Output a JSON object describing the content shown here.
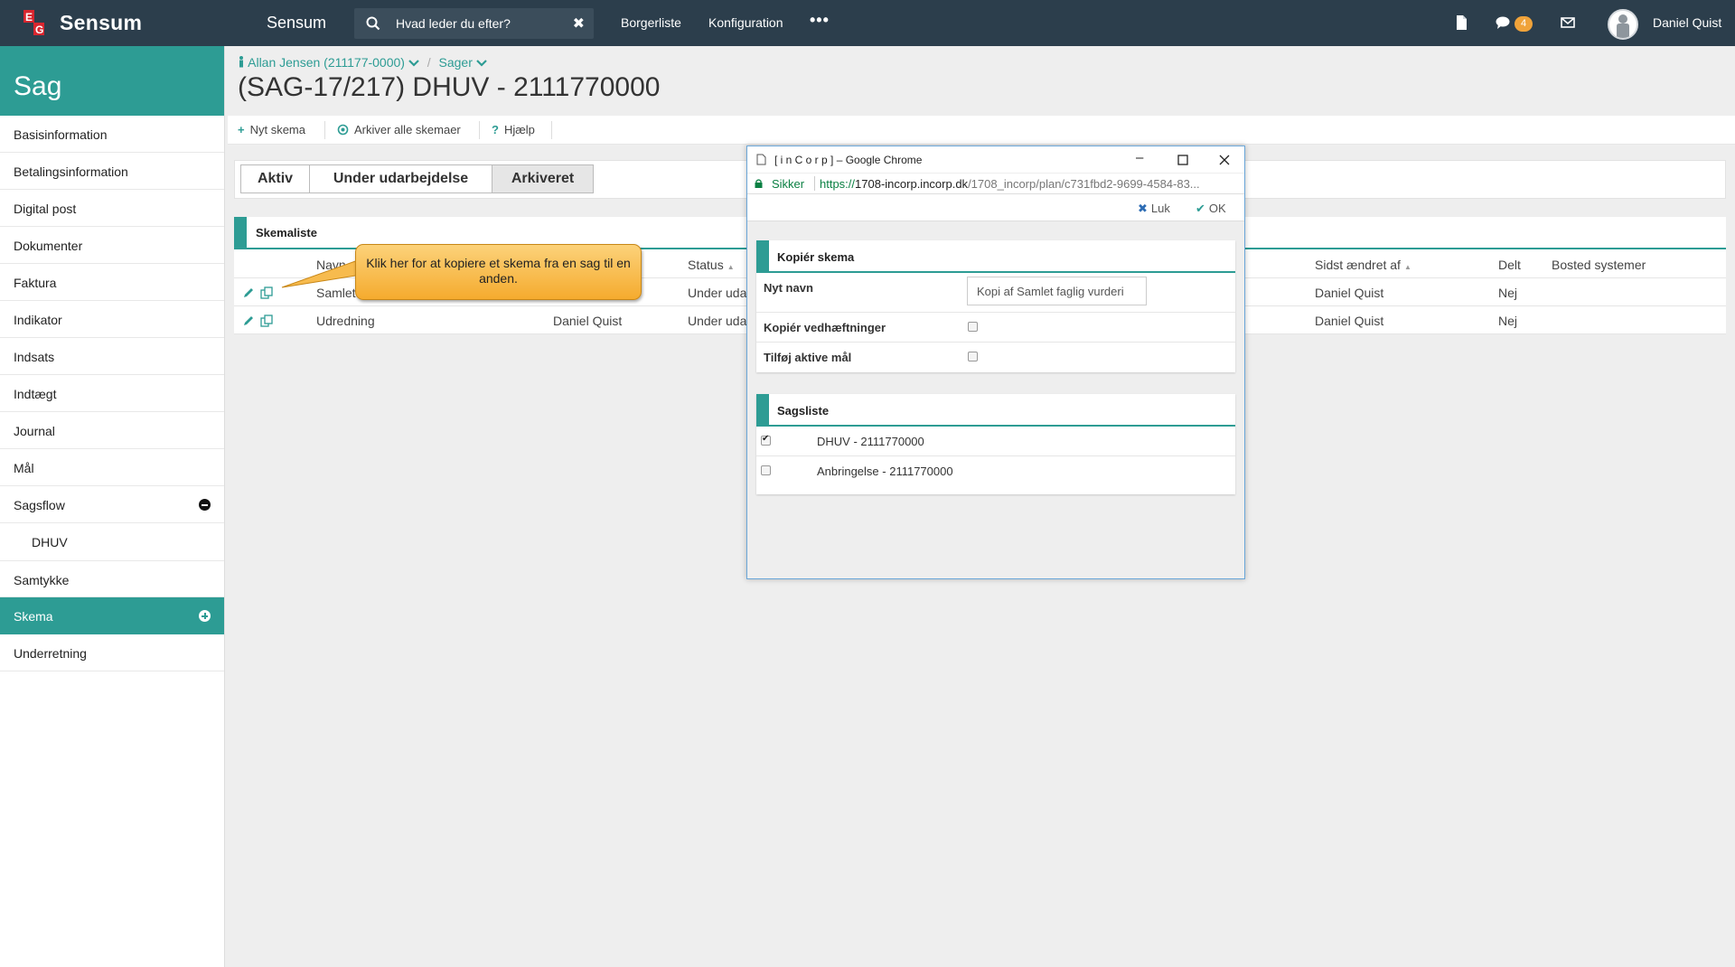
{
  "topbar": {
    "logo_text": "Sensum",
    "app_name": "Sensum",
    "search_placeholder": "Hvad leder du efter?",
    "search_clear": "✖",
    "nav": [
      "Borgerliste",
      "Konfiguration"
    ],
    "more": "•••",
    "badge_count": "4",
    "user_name": "Daniel Quist",
    "icons": [
      "file-icon",
      "chat-icon",
      "mail-icon",
      "avatar"
    ]
  },
  "sidebar": {
    "title": "Sag",
    "items": [
      {
        "label": "Basisinformation"
      },
      {
        "label": "Betalingsinformation"
      },
      {
        "label": "Digital post"
      },
      {
        "label": "Dokumenter"
      },
      {
        "label": "Faktura"
      },
      {
        "label": "Indikator"
      },
      {
        "label": "Indsats"
      },
      {
        "label": "Indtægt"
      },
      {
        "label": "Journal"
      },
      {
        "label": "Mål"
      },
      {
        "label": "Sagsflow"
      },
      {
        "label": "DHUV"
      },
      {
        "label": "Samtykke"
      },
      {
        "label": "Skema"
      },
      {
        "label": "Underretning"
      }
    ]
  },
  "breadcrumb": {
    "citizen": "Allan Jensen (211177-0000)",
    "sep": "/",
    "cases": "Sager"
  },
  "page_title": "(SAG-17/217) DHUV - 2111770000",
  "toolbar": {
    "new_form": "Nyt skema",
    "archive_all": "Arkiver alle skemaer",
    "help": "Hjælp"
  },
  "tabs": [
    "Aktiv",
    "Under udarbejdelse",
    "Arkiveret"
  ],
  "form_list": {
    "title": "Skemaliste",
    "columns": [
      "Navn",
      "Status",
      "Sidst ændret af",
      "Delt",
      "Bosted systemer"
    ],
    "rows": [
      {
        "name": "Samlet",
        "owner": "",
        "status": "Under uda",
        "changed_by": "Daniel Quist",
        "shared": "Nej"
      },
      {
        "name": "Udredning",
        "owner": "Daniel Quist",
        "status": "Under uda",
        "changed_by": "Daniel Quist",
        "shared": "Nej"
      }
    ]
  },
  "callout": {
    "text": "Klik her for at kopiere et skema fra en sag til en anden."
  },
  "popup": {
    "window_title": "[ i n C o r p ] – Google Chrome",
    "secure_label": "Sikker",
    "url_scheme": "https://",
    "url_domain": "1708-incorp.incorp.dk",
    "url_path": "/1708_incorp/plan/c731fbd2-9699-4584-83...",
    "close_label": "Luk",
    "ok_label": "OK",
    "copy_section": {
      "title": "Kopiér skema",
      "new_name_label": "Nyt navn",
      "new_name_value": "Kopi af Samlet faglig vurderi",
      "copy_attachments_label": "Kopiér vedhæftninger",
      "add_goals_label": "Tilføj aktive mål"
    },
    "case_section": {
      "title": "Sagsliste",
      "cases": [
        {
          "label": "DHUV - 2111770000",
          "checked": true
        },
        {
          "label": "Anbringelse - 2111770000",
          "checked": false
        }
      ]
    }
  },
  "colors": {
    "topbar": "#2c3e4c",
    "accent": "#2d9c94",
    "badge": "#f0a33a",
    "callout": "#f5ab2e"
  }
}
